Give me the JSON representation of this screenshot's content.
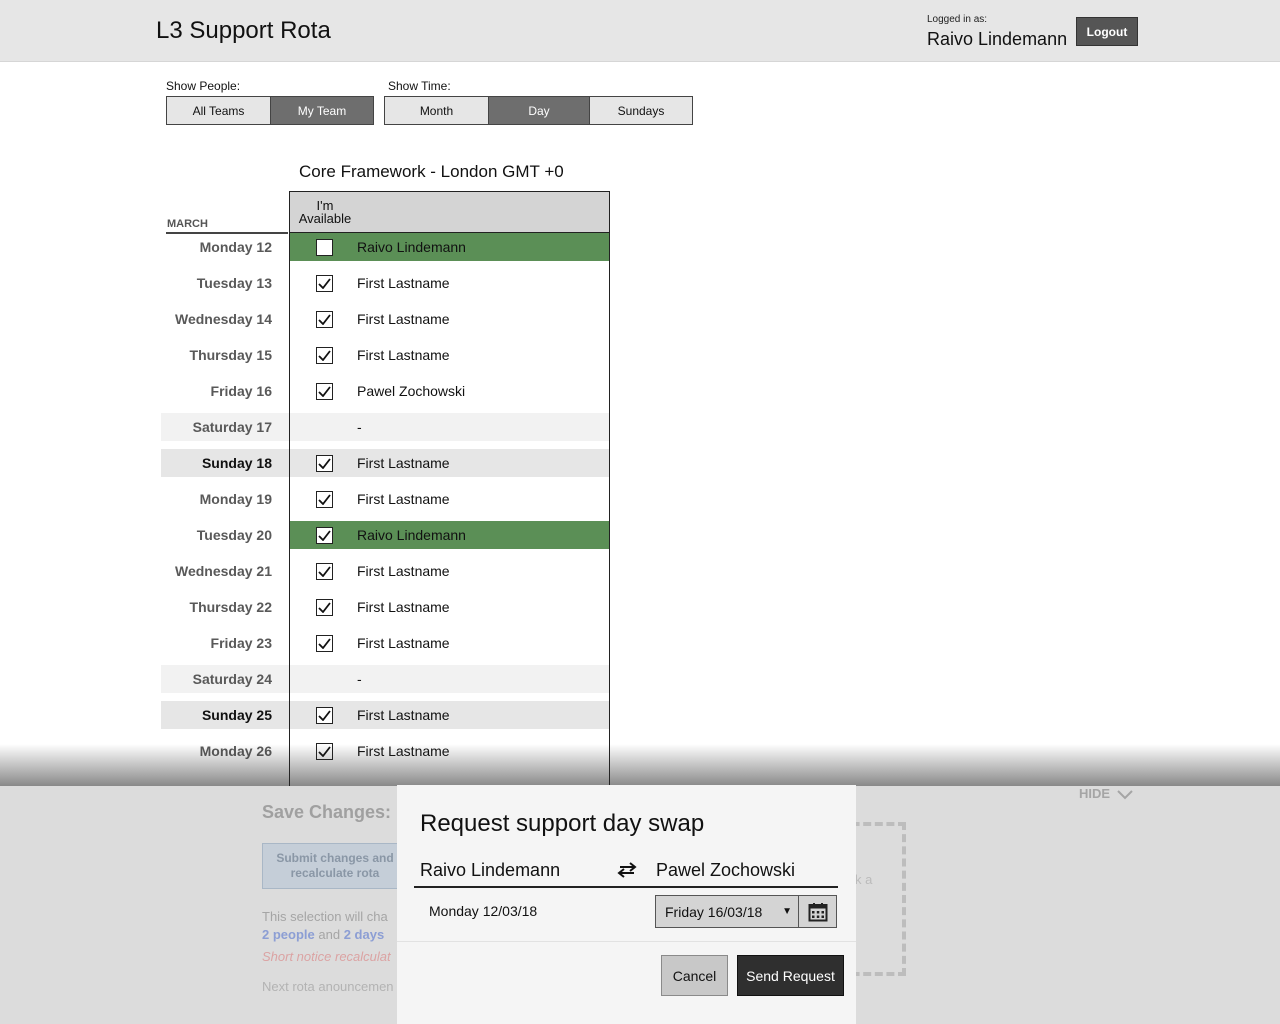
{
  "header": {
    "title": "L3 Support Rota",
    "logged_in_label": "Logged in as:",
    "user_name": "Raivo Lindemann",
    "logout_label": "Logout"
  },
  "filters": {
    "people_label": "Show People:",
    "people_options": [
      "All Teams",
      "My Team"
    ],
    "people_selected": "My Team",
    "time_label": "Show Time:",
    "time_options": [
      "Month",
      "Day",
      "Sundays"
    ],
    "time_selected": "Day"
  },
  "rota": {
    "team_title": "Core Framework - London GMT +0",
    "month": "MARCH",
    "available_header_line1": "I'm",
    "available_header_line2": "Available",
    "rows": [
      {
        "day": "Monday 12",
        "name": "Raivo Lindemann",
        "checked": false,
        "mine": true,
        "weekend": ""
      },
      {
        "day": "Tuesday 13",
        "name": "First Lastname",
        "checked": true,
        "mine": false,
        "weekend": ""
      },
      {
        "day": "Wednesday 14",
        "name": "First Lastname",
        "checked": true,
        "mine": false,
        "weekend": ""
      },
      {
        "day": "Thursday 15",
        "name": "First Lastname",
        "checked": true,
        "mine": false,
        "weekend": ""
      },
      {
        "day": "Friday 16",
        "name": "Pawel Zochowski",
        "checked": true,
        "mine": false,
        "weekend": ""
      },
      {
        "day": "Saturday 17",
        "name": "-",
        "checked": null,
        "mine": false,
        "weekend": "sat"
      },
      {
        "day": "Sunday 18",
        "name": "First Lastname",
        "checked": true,
        "mine": false,
        "weekend": "sun"
      },
      {
        "day": "Monday 19",
        "name": "First Lastname",
        "checked": true,
        "mine": false,
        "weekend": ""
      },
      {
        "day": "Tuesday 20",
        "name": "Raivo Lindemann",
        "checked": true,
        "mine": true,
        "weekend": ""
      },
      {
        "day": "Wednesday 21",
        "name": "First Lastname",
        "checked": true,
        "mine": false,
        "weekend": ""
      },
      {
        "day": "Thursday 22",
        "name": "First Lastname",
        "checked": true,
        "mine": false,
        "weekend": ""
      },
      {
        "day": "Friday 23",
        "name": "First Lastname",
        "checked": true,
        "mine": false,
        "weekend": ""
      },
      {
        "day": "Saturday 24",
        "name": "-",
        "checked": null,
        "mine": false,
        "weekend": "sat"
      },
      {
        "day": "Sunday 25",
        "name": "First Lastname",
        "checked": true,
        "mine": false,
        "weekend": "sun"
      },
      {
        "day": "Monday 26",
        "name": "First Lastname",
        "checked": true,
        "mine": false,
        "weekend": ""
      }
    ]
  },
  "save_panel": {
    "hide_label": "HIDE",
    "title": "Save Changes:",
    "submit_label_line1": "Submit changes and",
    "submit_label_line2": "recalculate rota",
    "selection_text": "This selection will cha",
    "people_count": "2 people",
    "and_text": "and",
    "days_count": "2 days",
    "short_notice": "Short notice recalculat",
    "next_rota": "Next rota anouncemen",
    "drop_hint": "k a"
  },
  "modal": {
    "title": "Request support day swap",
    "from_person": "Raivo Lindemann",
    "to_person": "Pawel Zochowski",
    "from_date": "Monday 12/03/18",
    "to_date": "Friday 16/03/18",
    "cancel_label": "Cancel",
    "send_label": "Send Request"
  },
  "colors": {
    "mine_row": "#5b8f56",
    "active_segment": "#6e6e6e",
    "send_button": "#2f2f2f"
  }
}
